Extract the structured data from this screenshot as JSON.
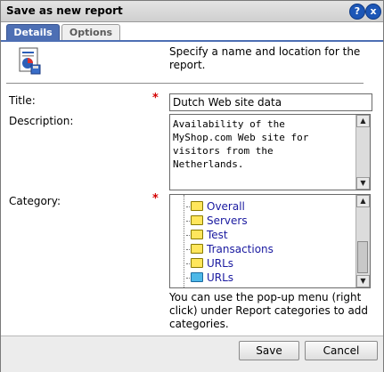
{
  "dialog": {
    "title": "Save as new report",
    "help_label": "?",
    "close_label": "x"
  },
  "tabs": [
    {
      "label": "Details"
    },
    {
      "label": "Options"
    }
  ],
  "intro": "Specify a name and location for the report.",
  "form": {
    "title_label": "Title:",
    "title_value": "Dutch Web site data",
    "description_label": "Description:",
    "description_value": "Availability of the MyShop.com Web site for visitors from the Netherlands.",
    "category_label": "Category:",
    "required_mark": "*"
  },
  "categories": [
    {
      "label": "Overall",
      "icon": "folder-report-icon"
    },
    {
      "label": "Servers",
      "icon": "folder-report-icon"
    },
    {
      "label": "Test",
      "icon": "folder-icon"
    },
    {
      "label": "Transactions",
      "icon": "folder-report-icon"
    },
    {
      "label": "URLs",
      "icon": "folder-report-icon"
    },
    {
      "label": "URLs",
      "icon": "folder-blue-icon"
    }
  ],
  "hint": "You can use the pop-up menu (right click) under Report categories to add categories.",
  "buttons": {
    "save": "Save",
    "cancel": "Cancel"
  },
  "colors": {
    "tab_active": "#4d6fb4",
    "required": "#d40000",
    "tree_text": "#1a1aa0",
    "title_button": "#1d57b7"
  }
}
